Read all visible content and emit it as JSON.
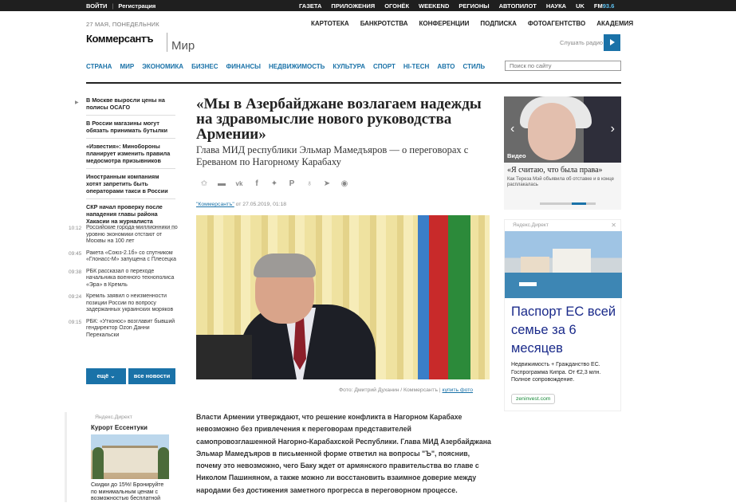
{
  "topbar": {
    "login": "ВОЙТИ",
    "register": "Регистрация",
    "links": [
      "ГАЗЕТА",
      "ПРИЛОЖЕНИЯ",
      "ОГОНЁК",
      "WEEKEND",
      "РЕГИОНЫ",
      "АВТОПИЛОТ",
      "НАУКА",
      "UK"
    ],
    "fm": "FM",
    "fm_freq": "93.6"
  },
  "header": {
    "date": "27 МАЯ, ПОНЕДЕЛЬНИК",
    "logo": "Коммерсантъ",
    "section": "Мир",
    "util_links": [
      "КАРТОТЕКА",
      "БАНКРОТСТВА",
      "КОНФЕРЕНЦИИ",
      "ПОДПИСКА",
      "ФОТОАГЕНТСТВО",
      "АКАДЕМИЯ"
    ],
    "radio_label": "Слушать радио",
    "nav": [
      "СТРАНА",
      "МИР",
      "ЭКОНОМИКА",
      "БИЗНЕС",
      "ФИНАНСЫ",
      "НЕДВИЖИМОСТЬ",
      "КУЛЬТУРА",
      "СПОРТ",
      "HI-TECH",
      "АВТО",
      "СТИЛЬ"
    ],
    "search_placeholder": "Поиск по сайту"
  },
  "top_news": [
    "В Москве выросли цены на полисы ОСАГО",
    "В России магазины могут обязать принимать бутылки",
    "«Известия»: Минобороны планирует изменить правила медосмотра призывников",
    "Иностранным компаниям хотят запретить быть операторами такси в России",
    "СКР начал проверку после нападения главы района Хакасии на журналиста"
  ],
  "feed": [
    {
      "time": "10:12",
      "text": "Российские города-миллионники по уровню экономики отстают от Москвы на 100 лет"
    },
    {
      "time": "09:45",
      "text": "Ракета «Союз-2.1б» со спутником «Глонасс-М» запущена с Плесецка"
    },
    {
      "time": "09:38",
      "text": "РБК рассказал о переходе начальника военного технополиса «Эра» в Кремль"
    },
    {
      "time": "09:24",
      "text": "Кремль заявил о неизменности позиции России по вопросу задержанных украинских моряков"
    },
    {
      "time": "09:15",
      "text": "РБК: «Утконос» возглавит бывший гендиректор Ozon Данни Перекальски"
    }
  ],
  "buttons": {
    "more": "ещё",
    "all_news": "все новости"
  },
  "ad_left": {
    "tag": "Яндекс.Директ",
    "title": "Курорт Ессентуки",
    "desc": "Скидки до 15%! Бронируйте по минимальным ценам с возможностью бесплатной"
  },
  "article": {
    "headline": "«Мы в Азербайджане возлагаем надежды на здравомыслие нового руководства Армении»",
    "subhead": "Глава МИД республики Эльмар Мамедъяров — о переговорах с Ереваном по Нагорному Карабаху",
    "byline_source": "\"Коммерсантъ\"",
    "byline_date": "от 27.05.2019, 01:18",
    "photo_caption": "Фото: Дмитрий Духанин / Коммерсантъ",
    "buy_photo": "купить фото",
    "lead": "Власти Армении утверждают, что решение конфликта в Нагорном Карабахе невозможно без привлечения к переговорам представителей самопровозглашенной Нагорно-Карабахской Республики. Глава МИД Азербайджана Эльмар Мамедъяров в письменной форме ответил на вопросы \"Ъ\", пояснив, почему это невозможно, чего Баку ждет от армянского правительства во главе с Николом Пашиняном, а также можно ли восстановить взаимное доверие между народами без достижения заметного прогресса в переговорном процессе."
  },
  "video": {
    "label": "Видео",
    "title": "«Я считаю, что была права»",
    "desc": "Как Тереза Мэй объявила об отставке и в конце расплакалась"
  },
  "ad_right": {
    "tag": "Яндекс.Директ",
    "headline": "Паспорт ЕС всей семье за 6 месяцев",
    "body": "Недвижимость + Гражданство ЕС. Госпрограмма Кипра. От €2,3 млн. Полное сопровождение.",
    "link": "zeninvest.com"
  }
}
